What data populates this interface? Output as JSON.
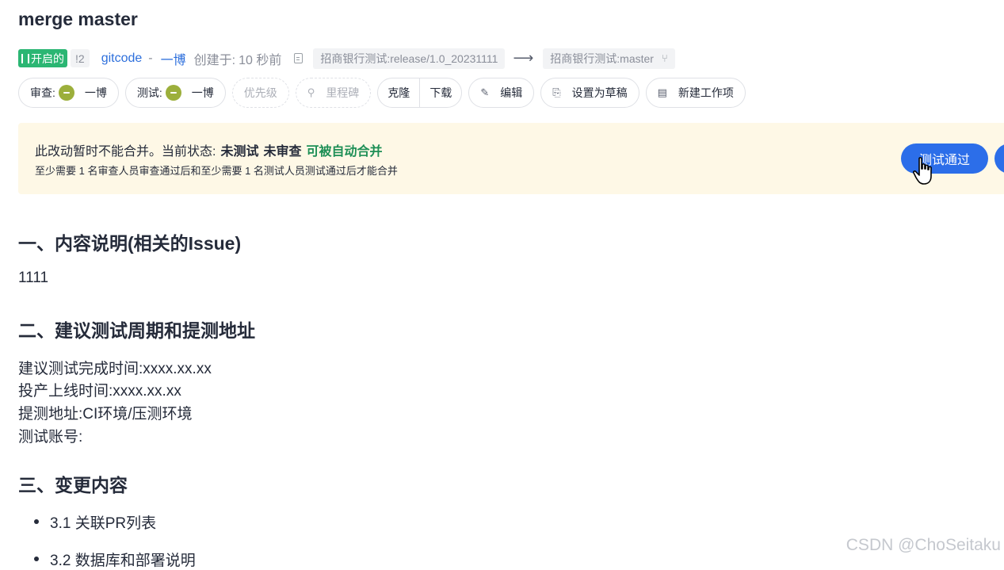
{
  "title": "merge master",
  "meta": {
    "status": "开启的",
    "mr_count": "!2",
    "repo": "gitcode",
    "separator": "-",
    "author": "一博",
    "created_label": "创建于:",
    "created_time": "10 秒前",
    "source_branch": "招商银行测试:release/1.0_20231111",
    "arrow": "⟶",
    "target_branch": "招商银行测试:master"
  },
  "actions": {
    "reviewer_label": "审查:",
    "reviewer_name": "一博",
    "tester_label": "测试:",
    "tester_name": "一博",
    "priority": "优先级",
    "milestone": "里程碑",
    "clone": "克隆",
    "download": "下载",
    "edit": "编辑",
    "draft": "设置为草稿",
    "new_work_item": "新建工作项"
  },
  "notice": {
    "intro": "此改动暂时不能合并。当前状态:",
    "state_untested": "未测试",
    "state_unreviewed": "未审查",
    "state_auto_merge": "可被自动合并",
    "requirement": "至少需要 1 名审查人员审查通过后和至少需要 1 名测试人员测试通过后才能合并",
    "pass_button": "测试通过"
  },
  "body": {
    "h1": "一、内容说明(相关的Issue)",
    "p1": "1111",
    "h2": "二、建议测试周期和提测地址",
    "lines": [
      "建议测试完成时间:xxxx.xx.xx",
      "投产上线时间:xxxx.xx.xx",
      "提测地址:CI环境/压测环境",
      "测试账号:"
    ],
    "h3": "三、变更内容",
    "items": [
      "3.1 关联PR列表",
      "3.2 数据库和部署说明"
    ]
  },
  "watermark": "CSDN @ChoSeitaku",
  "colors": {
    "primary": "#2c6ee9",
    "status_green": "#2bb673",
    "notice_bg": "#fef8e6",
    "ok_text": "#1e8f56"
  }
}
